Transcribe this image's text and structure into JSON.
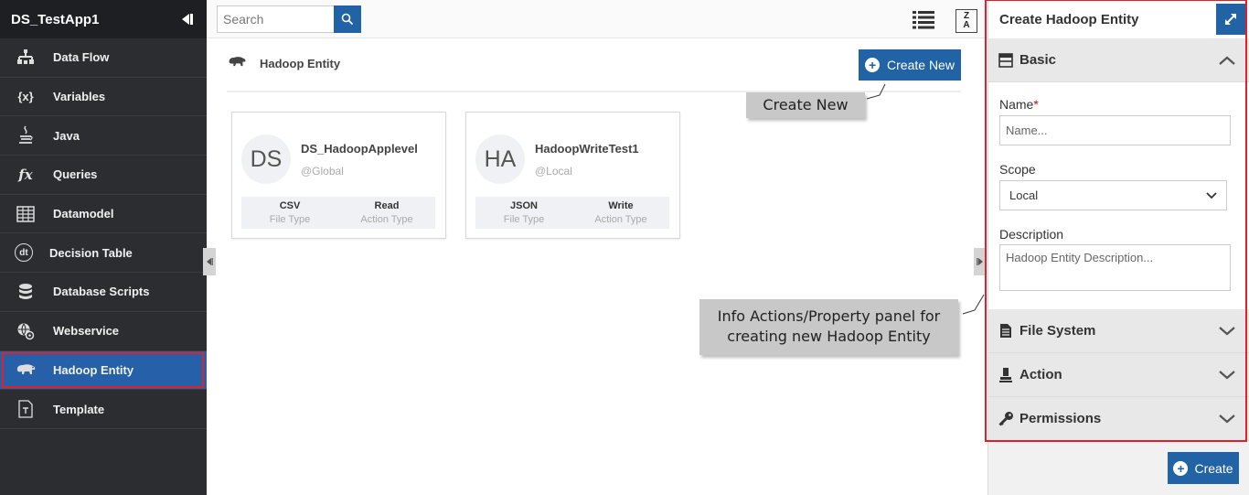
{
  "sidebar": {
    "app_title": "DS_TestApp1",
    "items": [
      {
        "label": "Data Flow",
        "icon": "data-flow-icon"
      },
      {
        "label": "Variables",
        "icon": "variables-icon",
        "glyph": "{x}"
      },
      {
        "label": "Java",
        "icon": "java-icon"
      },
      {
        "label": "Queries",
        "icon": "queries-icon",
        "glyph": "fx"
      },
      {
        "label": "Datamodel",
        "icon": "datamodel-icon"
      },
      {
        "label": "Decision Table",
        "icon": "decision-table-icon",
        "glyph": "dt"
      },
      {
        "label": "Database Scripts",
        "icon": "database-icon"
      },
      {
        "label": "Webservice",
        "icon": "webservice-icon"
      },
      {
        "label": "Hadoop Entity",
        "icon": "hadoop-icon",
        "active": true
      },
      {
        "label": "Template",
        "icon": "template-icon",
        "glyph": "T"
      }
    ]
  },
  "toolbar": {
    "search_placeholder": "Search",
    "sort_glyph_top": "Z",
    "sort_glyph_bottom": "A"
  },
  "entity": {
    "section_title": "Hadoop Entity",
    "create_new_label": "Create New"
  },
  "cards": [
    {
      "initials": "DS",
      "name": "DS_HadoopApplevel",
      "scope": "@Global",
      "file_type": "CSV",
      "file_type_label": "File Type",
      "action_type": "Read",
      "action_type_label": "Action Type"
    },
    {
      "initials": "HA",
      "name": "HadoopWriteTest1",
      "scope": "@Local",
      "file_type": "JSON",
      "file_type_label": "File Type",
      "action_type": "Write",
      "action_type_label": "Action Type"
    }
  ],
  "callouts": {
    "create_new": "Create New",
    "info_panel_line1": "Info Actions/Property panel for",
    "info_panel_line2": "creating new Hadoop Entity"
  },
  "panel": {
    "title": "Create Hadoop Entity",
    "basic_label": "Basic",
    "name_label": "Name",
    "name_required": "*",
    "name_placeholder": "Name...",
    "scope_label": "Scope",
    "scope_value": "Local",
    "description_label": "Description",
    "description_placeholder": "Hadoop Entity Description...",
    "file_system_label": "File System",
    "action_label": "Action",
    "permissions_label": "Permissions",
    "create_label": "Create"
  },
  "colors": {
    "accent": "#2263a5",
    "sidebar_bg": "#2b2d31",
    "highlight_red": "#e0202a"
  }
}
